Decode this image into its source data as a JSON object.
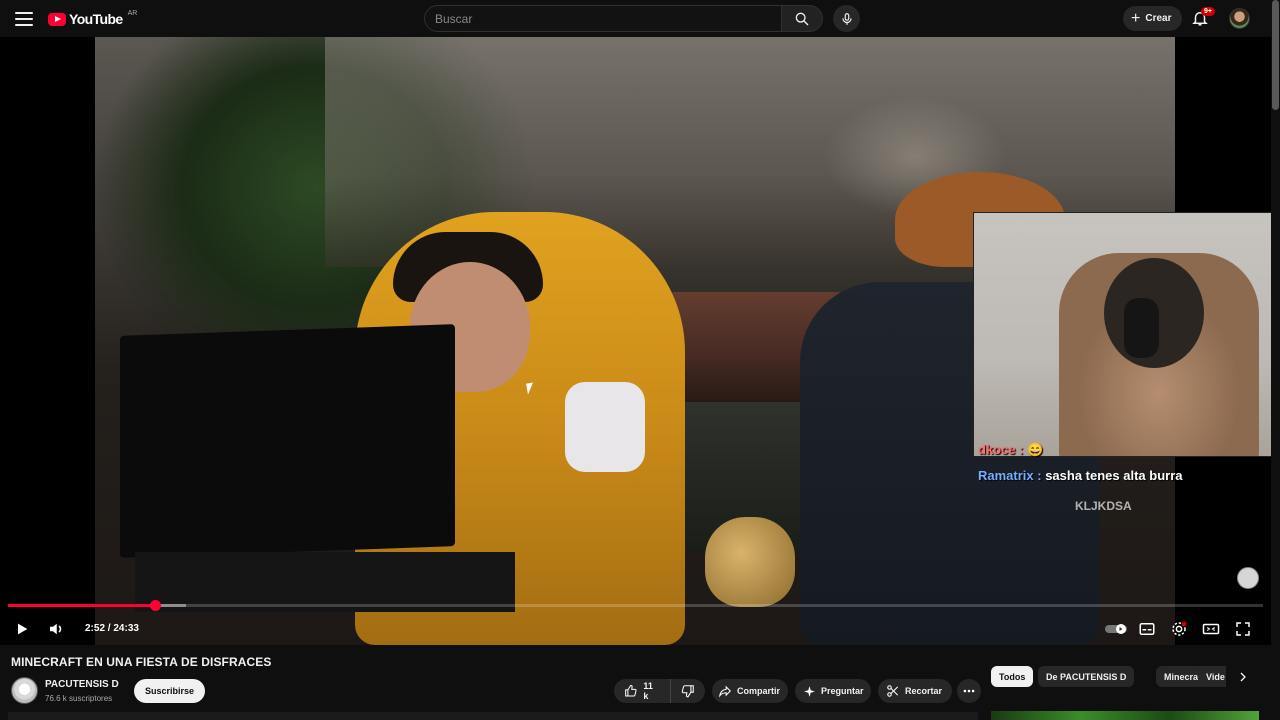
{
  "header": {
    "logo_text": "YouTube",
    "region": "AR",
    "search_placeholder": "Buscar",
    "create_label": "Crear",
    "notifications_badge": "9+"
  },
  "player": {
    "current_time": "2:52",
    "separator": "/",
    "duration": "24:33",
    "progress_fraction": 0.117,
    "buffer_fraction": 0.142,
    "chat": [
      {
        "user": "dkoce :",
        "message": "",
        "user_color": "#ff6b6b"
      },
      {
        "user": "Ramatrix :",
        "message": "sasha tenes alta burra",
        "user_color": "#6fb1ff"
      }
    ],
    "chat_overlay_text": "KLJKDSA"
  },
  "video": {
    "title": "MINECRAFT EN UNA FIESTA DE DISFRACES",
    "channel_name": "PACUTENSIS D",
    "subscribers": "76.6 k suscriptores",
    "subscribe_label": "Suscribirse"
  },
  "actions": {
    "like_count": "11 k",
    "share_label": "Compartir",
    "ask_label": "Preguntar",
    "clip_label": "Recortar"
  },
  "chips": [
    {
      "label": "Todos",
      "active": true
    },
    {
      "label": "De PACUTENSIS D",
      "active": false
    },
    {
      "label": "Minecraft",
      "active": false
    },
    {
      "label": "Vide",
      "active": false
    }
  ],
  "colors": {
    "accent": "#ff0033",
    "background": "#0f0f0f",
    "surface": "#272727"
  }
}
